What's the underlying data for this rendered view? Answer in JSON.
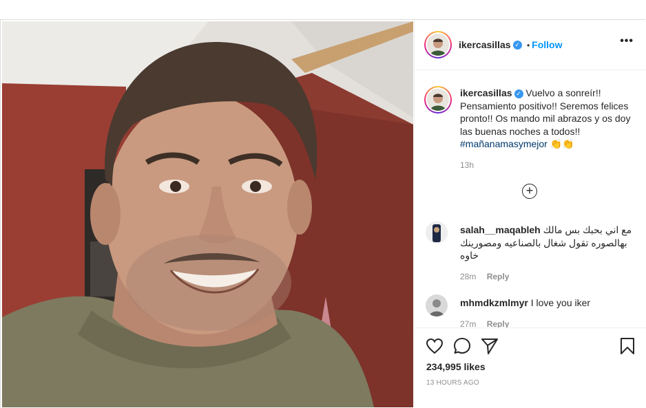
{
  "post": {
    "username": "ikercasillas",
    "verified_icon": "verified-badge-icon",
    "follow_label": "Follow",
    "follow_sep": "•",
    "more_label": "•••",
    "caption_text": "Vuelvo a sonreír!! Pensamiento positivo!! Seremos felices pronto!! Os mando mil abrazos y os doy las buenas noches a todos!!",
    "caption_hashtag": "#mañanamasymejor",
    "caption_emoji": "👏👏",
    "caption_time": "13h",
    "load_more_label": "+",
    "likes": "234,995 likes",
    "time_ago": "13 HOURS AGO"
  },
  "comments": [
    {
      "username": "salah__maqableh",
      "text": "مع اني بحبك بس مالك بهالصوره تقول شغال بالصناعيه ومصورينك خاوه",
      "time": "28m",
      "reply": "Reply"
    },
    {
      "username": "mhmdkzmlmyr",
      "text": "I love you iker",
      "time": "27m",
      "reply": "Reply"
    }
  ],
  "icons": {
    "like": "heart-icon",
    "comment": "comment-icon",
    "share": "share-icon",
    "save": "bookmark-icon"
  },
  "colors": {
    "follow": "#0095f6",
    "hashtag": "#00376b",
    "verified": "#3897f0",
    "meta": "#8e8e8e"
  }
}
